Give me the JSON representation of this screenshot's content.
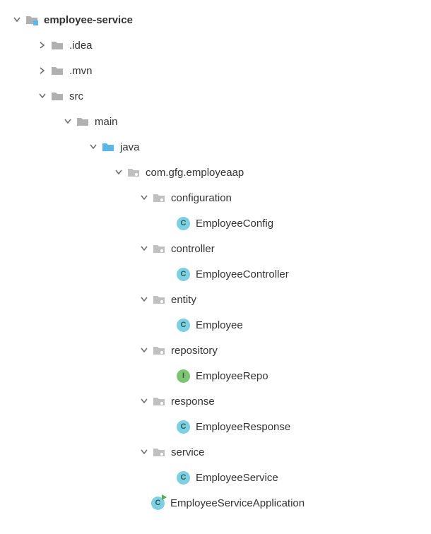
{
  "tree": {
    "root": {
      "label": "employee-service",
      "children": {
        "idea": {
          "label": ".idea"
        },
        "mvn": {
          "label": ".mvn"
        },
        "src": {
          "label": "src",
          "main": {
            "label": "main",
            "java": {
              "label": "java",
              "package": {
                "label": "com.gfg.employeaap",
                "configuration": {
                  "label": "configuration",
                  "cls": {
                    "label": "EmployeeConfig"
                  }
                },
                "controller": {
                  "label": "controller",
                  "cls": {
                    "label": "EmployeeController"
                  }
                },
                "entity": {
                  "label": "entity",
                  "cls": {
                    "label": "Employee"
                  }
                },
                "repository": {
                  "label": "repository",
                  "cls": {
                    "label": "EmployeeRepo"
                  }
                },
                "response": {
                  "label": "response",
                  "cls": {
                    "label": "EmployeeResponse"
                  }
                },
                "service": {
                  "label": "service",
                  "cls": {
                    "label": "EmployeeService"
                  }
                },
                "app": {
                  "label": "EmployeeServiceApplication"
                }
              }
            }
          }
        }
      }
    }
  },
  "glyphs": {
    "class_letter": "C",
    "interface_letter": "I"
  }
}
